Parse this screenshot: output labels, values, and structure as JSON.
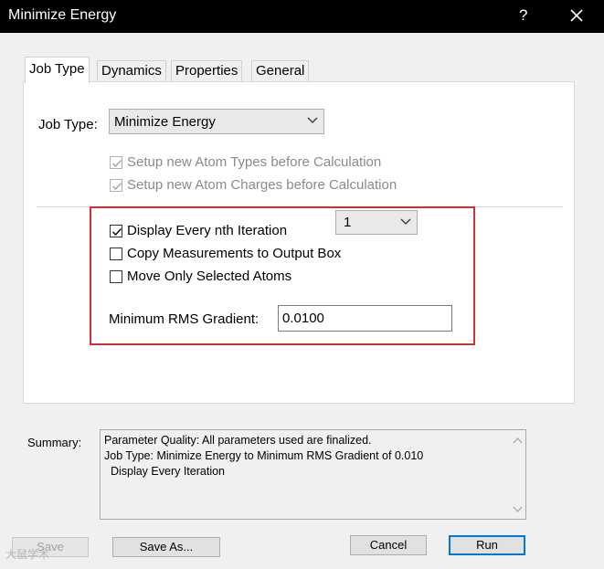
{
  "window": {
    "title": "Minimize Energy",
    "help_glyph": "?"
  },
  "tabs": [
    {
      "label": "Job Type",
      "active": true
    },
    {
      "label": "Dynamics"
    },
    {
      "label": "Properties"
    },
    {
      "label": "General"
    }
  ],
  "job_type": {
    "label": "Job Type:",
    "selected": "Minimize Energy",
    "setup_atom_types": {
      "label": "Setup new Atom Types before Calculation",
      "checked": true,
      "enabled": false
    },
    "setup_atom_charges": {
      "label": "Setup new Atom Charges before Calculation",
      "checked": true,
      "enabled": false
    }
  },
  "options": {
    "display_nth": {
      "label": "Display Every nth Iteration",
      "checked": true
    },
    "nth_value": "1",
    "copy_measurements": {
      "label": "Copy Measurements to Output Box",
      "checked": false
    },
    "move_selected": {
      "label": "Move Only Selected Atoms",
      "checked": false
    },
    "rms_label": "Minimum RMS Gradient:",
    "rms_value": "0.0100"
  },
  "summary": {
    "label": "Summary:",
    "lines": [
      "Parameter Quality: All parameters used are finalized.",
      "Job Type: Minimize Energy to Minimum RMS Gradient of 0.010",
      "  Display Every Iteration"
    ]
  },
  "buttons": {
    "save": "Save",
    "save_as": "Save As...",
    "cancel": "Cancel",
    "run": "Run"
  },
  "watermark": "大鼠学术",
  "colors": {
    "highlight_border": "#d32f2f",
    "default_button_border": "#0078d7"
  }
}
